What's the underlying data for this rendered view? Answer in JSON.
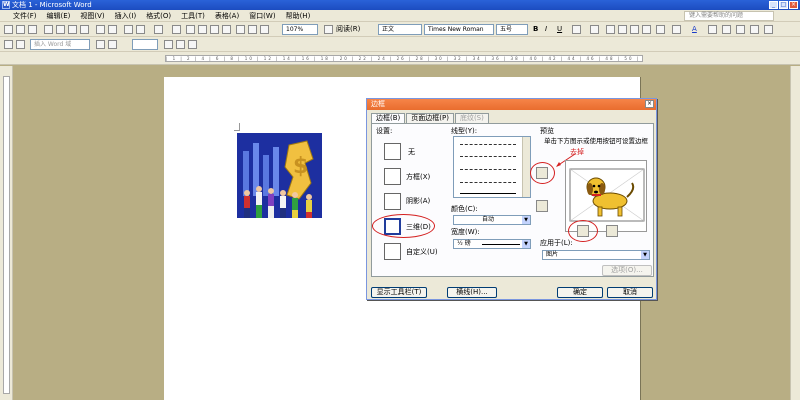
{
  "window": {
    "title": "文档 1 - Microsoft Word",
    "help_placeholder": "键入需要帮助的问题"
  },
  "menu": [
    "文件(F)",
    "编辑(E)",
    "视图(V)",
    "插入(I)",
    "格式(O)",
    "工具(T)",
    "表格(A)",
    "窗口(W)",
    "帮助(H)"
  ],
  "toolbar": {
    "zoom": "107%",
    "read_label": "阅读(R)",
    "style": "正文",
    "font": "Times New Roman",
    "size": "五号",
    "wordart_placeholder": "插入 Word 域"
  },
  "dialog": {
    "title": "边框",
    "tabs": [
      "边框(B)",
      "页面边框(P)",
      "底纹(S)"
    ],
    "setting_label": "设置:",
    "settings": [
      "无",
      "方框(X)",
      "阴影(A)",
      "三维(D)",
      "自定义(U)"
    ],
    "style_label": "线型(Y):",
    "color_label": "颜色(C):",
    "color_value": "自动",
    "width_label": "宽度(W):",
    "width_value": "½ 磅",
    "preview_label": "预览",
    "preview_hint": "单击下方图示或使用按钮可设置边框",
    "annotation": "去掉",
    "apply_label": "应用于(L):",
    "apply_value": "图片",
    "options_button": "选项(O)...",
    "toolbar_button": "显示工具栏(T)",
    "hline_button": "横线(H)...",
    "ok_button": "确定",
    "cancel_button": "取消"
  },
  "colors": {
    "titlebar": "#2a62d8",
    "dialog_title": "#f07a3c",
    "annotation": "#d42020",
    "workspace": "#b8ae84"
  }
}
